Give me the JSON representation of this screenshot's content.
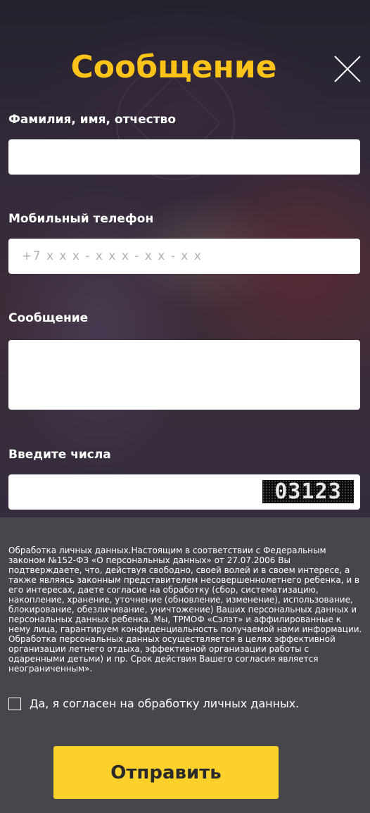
{
  "modal": {
    "title": "Сообщение",
    "close_icon": "close-icon",
    "accent_color": "#fcc418"
  },
  "form": {
    "name_label": "Фамилия, имя, отчество",
    "name_value": "",
    "phone_label": "Мобильный телефон",
    "phone_placeholder": "+7 x x x - x x x - x x - x x",
    "phone_value": "",
    "message_label": "Сообщение",
    "message_value": "",
    "captcha_label": "Введите числа",
    "captcha_value": "",
    "captcha_code": "03123",
    "consent_text": "Обработка личных данных.Настоящим в соответствии с Федеральным законом №152-ФЗ «О персональных данных» от 27.07.2006 Вы подтверждаете, что, действуя свободно, своей волей и в своем интересе, а также являясь законным представителем несовершеннолетнего ребенка, и в его интересах, даете согласие на обработку (сбор, систематизацию, накопление, хранение, уточнение (обновление, изменение), использование, блокирование, обезличивание, уничтожение) Ваших персональных данных и персональных данных ребенка. Мы, ТРМОФ «Сэлэт» и аффилированные к нему лица, гарантируем конфиденциальность получаемой нами информации. Обработка персональных данных осуществляется в целях эффективной организации летнего отдыха, эффективной организации работы с одаренными детьми) и пр. Срок действия Вашего согласия является неограниченным».",
    "consent_checkbox_label": "Да, я согласен на обработку личных данных.",
    "consent_checked": false,
    "submit_label": "Отправить",
    "submit_color": "#fcd12c"
  }
}
